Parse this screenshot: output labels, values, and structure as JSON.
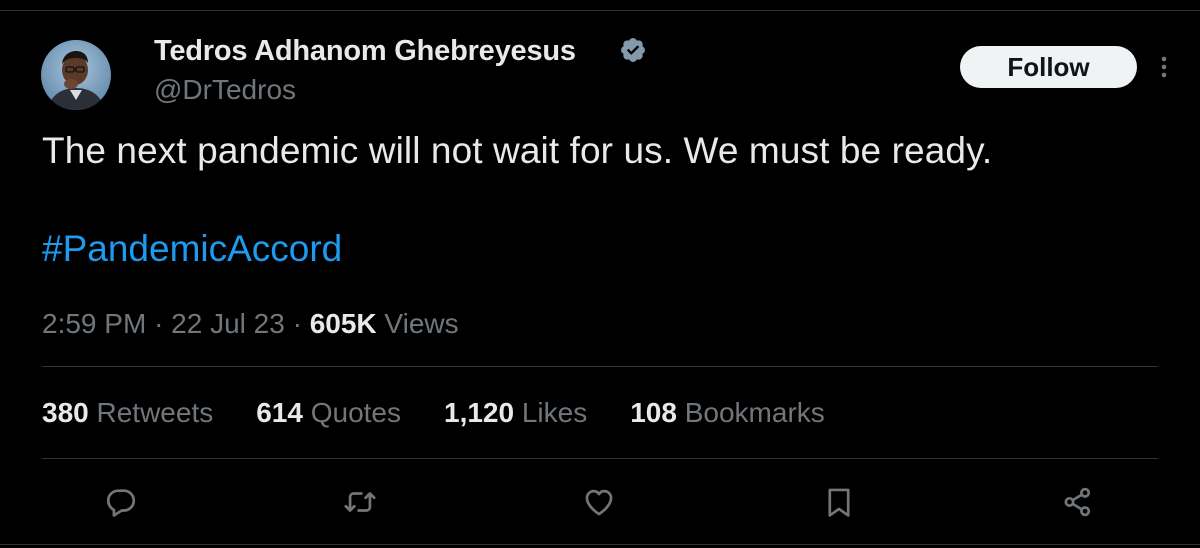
{
  "author": {
    "display_name": "Tedros Adhanom Ghebreyesus",
    "handle": "@DrTedros",
    "verified_icon": "verified-badge-icon",
    "avatar": "avatar"
  },
  "header": {
    "follow_label": "Follow",
    "more_icon": "more-options-icon"
  },
  "tweet": {
    "text": "The next pandemic will not wait for us. We must be ready.",
    "hashtag": "#PandemicAccord"
  },
  "meta": {
    "time": "2:59 PM",
    "separator": "·",
    "date": "22 Jul 23",
    "views_count": "605K",
    "views_label": "Views"
  },
  "stats": [
    {
      "count": "380",
      "label": "Retweets"
    },
    {
      "count": "614",
      "label": "Quotes"
    },
    {
      "count": "1,120",
      "label": "Likes"
    },
    {
      "count": "108",
      "label": "Bookmarks"
    }
  ],
  "actions": [
    "reply-icon",
    "retweet-icon",
    "like-icon",
    "bookmark-icon",
    "share-icon"
  ],
  "colors": {
    "background": "#000000",
    "text_primary": "#e7e9ea",
    "text_secondary": "#71767b",
    "link": "#1d9bf0",
    "verified": "#829aab",
    "divider": "#2f3336",
    "follow_bg": "#eff3f4"
  }
}
